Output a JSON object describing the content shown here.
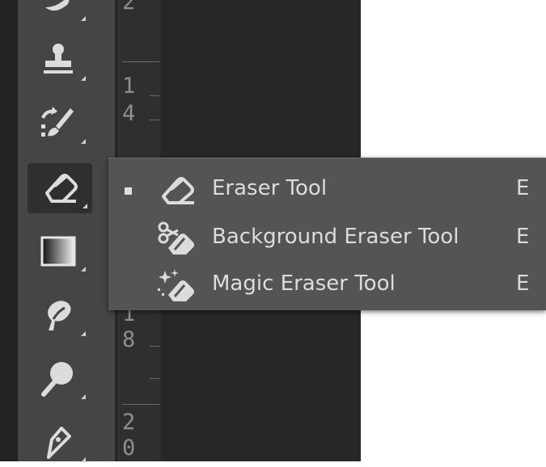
{
  "toolbar": {
    "tools": [
      {
        "name": "smudge-partial",
        "icon": "brush-partial-icon",
        "has_submenu": true
      },
      {
        "name": "clone-stamp",
        "icon": "stamp-icon",
        "has_submenu": true
      },
      {
        "name": "history-brush",
        "icon": "history-brush-icon",
        "has_submenu": true
      },
      {
        "name": "eraser",
        "icon": "eraser-icon",
        "has_submenu": true,
        "selected": true
      },
      {
        "name": "gradient",
        "icon": "gradient-icon",
        "has_submenu": true
      },
      {
        "name": "blur",
        "icon": "blur-drop-icon",
        "has_submenu": true
      },
      {
        "name": "dodge",
        "icon": "dodge-icon",
        "has_submenu": true
      },
      {
        "name": "pen",
        "icon": "pen-icon",
        "has_submenu": true
      }
    ]
  },
  "ruler": {
    "labels": [
      "2",
      "1",
      "4",
      "1",
      "8",
      "2",
      "0"
    ]
  },
  "flyout": {
    "items": [
      {
        "label": "Eraser Tool",
        "shortcut": "E",
        "icon": "eraser-icon",
        "selected": true
      },
      {
        "label": "Background Eraser Tool",
        "shortcut": "E",
        "icon": "background-eraser-icon",
        "selected": false
      },
      {
        "label": "Magic Eraser Tool",
        "shortcut": "E",
        "icon": "magic-eraser-icon",
        "selected": false
      }
    ]
  },
  "colors": {
    "toolbar_bg": "#454545",
    "canvas_bg": "#272727",
    "flyout_bg": "#545454",
    "text": "#dcdcdc"
  }
}
